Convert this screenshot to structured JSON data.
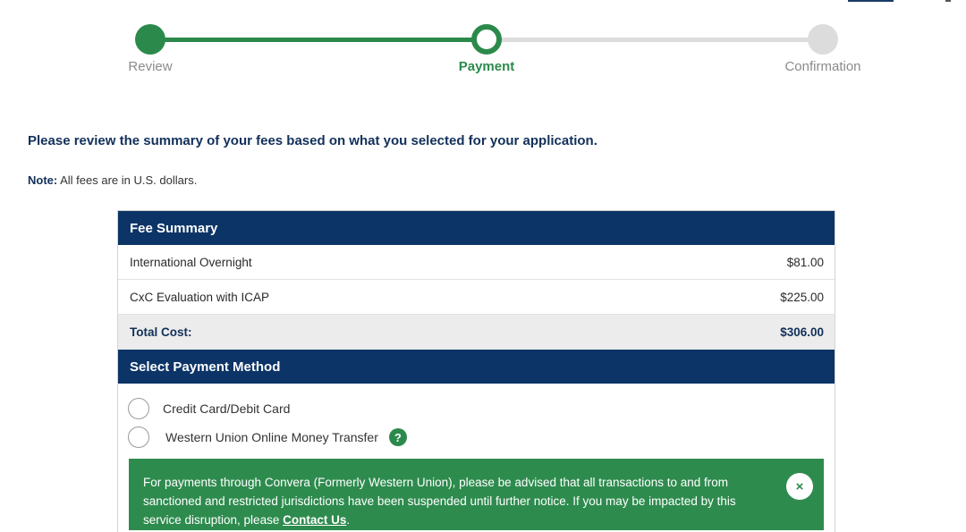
{
  "stepper": {
    "steps": [
      {
        "label": "Review",
        "state": "complete"
      },
      {
        "label": "Payment",
        "state": "current"
      },
      {
        "label": "Confirmation",
        "state": "upcoming"
      }
    ]
  },
  "intro": "Please review the summary of your fees based on what you selected for your application.",
  "note": {
    "prefix": "Note:",
    "text": "All fees are in U.S. dollars."
  },
  "fee_summary": {
    "title": "Fee Summary",
    "rows": [
      {
        "label": "International Overnight",
        "amount": "$81.00"
      },
      {
        "label": "CxC Evaluation with ICAP",
        "amount": "$225.00"
      }
    ],
    "total": {
      "label": "Total Cost:",
      "amount": "$306.00"
    }
  },
  "payment": {
    "title": "Select Payment Method",
    "options": [
      {
        "label": "Credit Card/Debit Card",
        "selected": false
      },
      {
        "label": "Western Union Online Money Transfer",
        "selected": false
      }
    ],
    "help_icon": "question-mark",
    "alert": {
      "text": "For payments through Convera (Formerly Western Union), please be advised that all transactions to and from sanctioned and restricted jurisdictions have been suspended until further notice. If you may be impacted by this service disruption, please ",
      "link": "Contact Us",
      "suffix": ".",
      "close_icon": "×"
    }
  },
  "colors": {
    "brand_navy": "#0c3467",
    "success_green": "#2b8a4b"
  }
}
